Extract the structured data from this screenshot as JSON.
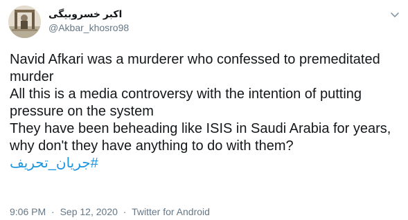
{
  "author": {
    "display_name": "اکبر خسروبیگی",
    "handle": "@Akbar_khosro98"
  },
  "tweet": {
    "lines": [
      "Navid Afkari was a murderer who confessed to premeditated murder",
      "All this is a media controversy with the intention of putting pressure on the system",
      "They have been beheading like ISIS in Saudi Arabia for years, why don't they have anything to do with them?"
    ],
    "hashtag": "#جریان_تحریف"
  },
  "meta": {
    "time": "9:06 PM",
    "separator": "·",
    "date": "Sep 12, 2020",
    "source": "Twitter for Android"
  },
  "colors": {
    "link": "#1b95e0",
    "secondary_text": "#657786",
    "primary_text": "#14171a"
  },
  "icons": {
    "menu": "chevron-down-icon",
    "avatar": "avatar-image"
  }
}
